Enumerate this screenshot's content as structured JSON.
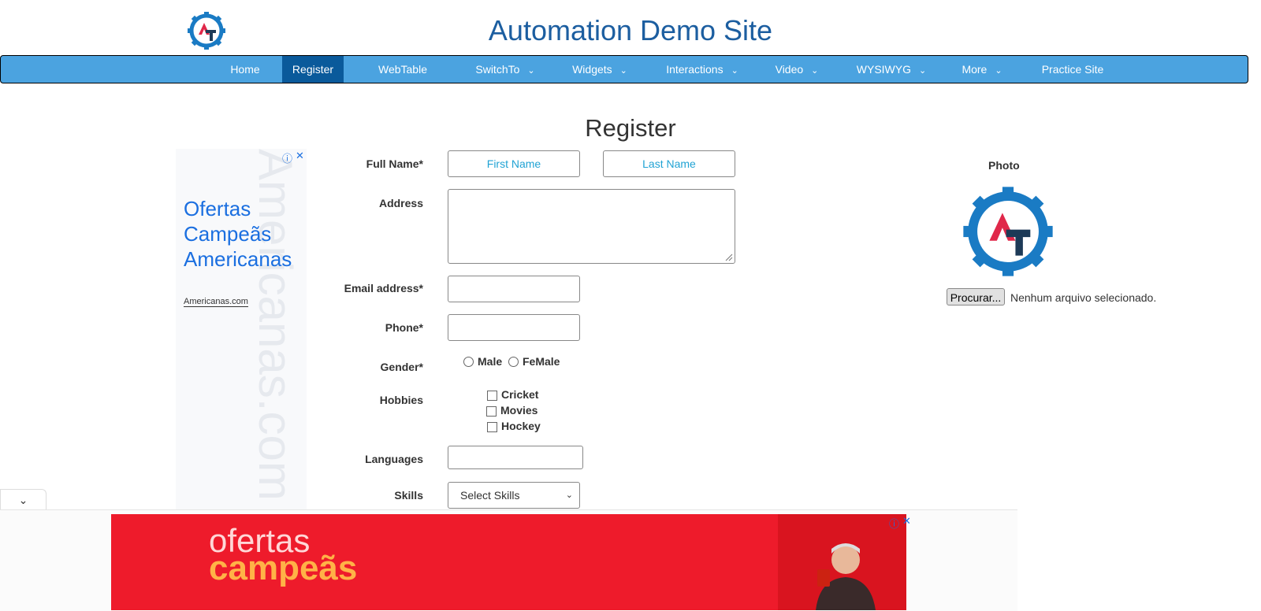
{
  "site": {
    "title": "Automation Demo Site"
  },
  "nav": {
    "items": [
      {
        "label": "Home"
      },
      {
        "label": "Register"
      },
      {
        "label": "WebTable"
      },
      {
        "label": "SwitchTo"
      },
      {
        "label": "Widgets"
      },
      {
        "label": "Interactions"
      },
      {
        "label": "Video"
      },
      {
        "label": "WYSIWYG"
      },
      {
        "label": "More"
      },
      {
        "label": "Practice Site"
      }
    ],
    "active": "Register"
  },
  "page": {
    "heading": "Register"
  },
  "ad_left": {
    "text_line1": "Ofertas",
    "text_line2": "Campeãs",
    "text_line3": "Americanas",
    "link": "Americanas.com",
    "watermark": "Americanas.com"
  },
  "form": {
    "full_name_label": "Full Name*",
    "first_name_placeholder": "First Name",
    "last_name_placeholder": "Last Name",
    "address_label": "Address",
    "email_label": "Email address*",
    "phone_label": "Phone*",
    "gender_label": "Gender*",
    "gender_options": [
      "Male",
      "FeMale"
    ],
    "hobbies_label": "Hobbies",
    "hobbies": [
      "Cricket",
      "Movies",
      "Hockey"
    ],
    "languages_label": "Languages",
    "skills_label": "Skills",
    "skills_selected": "Select Skills"
  },
  "photo": {
    "label": "Photo",
    "button": "Procurar...",
    "status": "Nenhum arquivo selecionado."
  },
  "bottom_ad": {
    "line1": "ofertas",
    "line2": "campeãs"
  },
  "colors": {
    "nav_bg": "#4ba3e0",
    "nav_active": "#0a5a9b",
    "title": "#1c5ea0",
    "ad_red": "#ee1b2b"
  }
}
